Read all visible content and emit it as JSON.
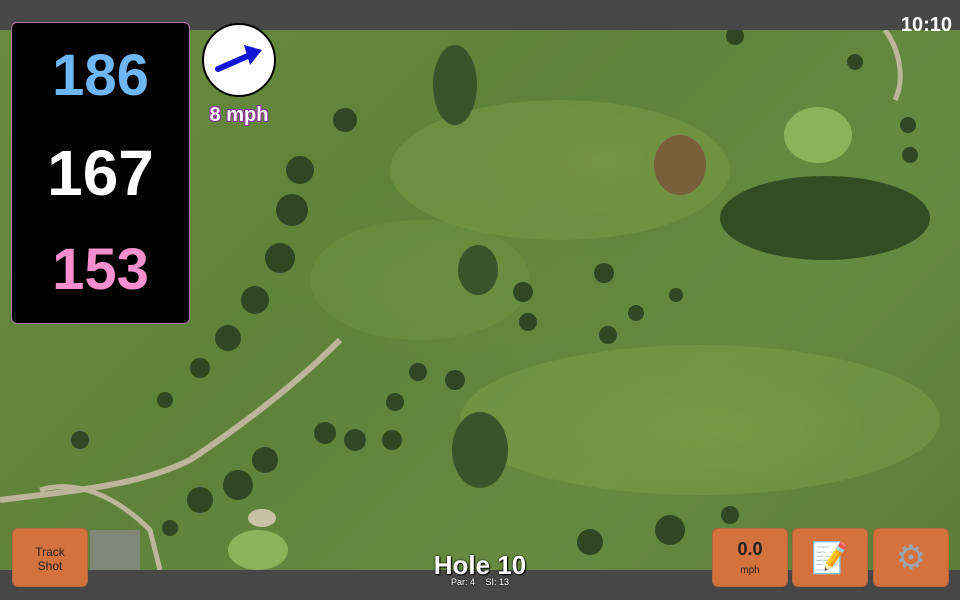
{
  "clock": "10:10",
  "yardages": {
    "back": "186",
    "middle": "167",
    "front": "153"
  },
  "wind": {
    "speed_label": "8 mph",
    "direction_icon": "arrow-icon"
  },
  "hole": {
    "title": "Hole 10",
    "par": "Par: 4",
    "si": "SI: 13"
  },
  "buttons": {
    "track_line1": "Track",
    "track_line2": "Shot",
    "speed_value": "0.0",
    "speed_unit": "mph",
    "notes_icon": "notepad-icon",
    "settings_icon": "gear-icon"
  },
  "colors": {
    "back_yardage": "#6fb6f5",
    "middle_yardage": "#ffffff",
    "front_yardage": "#f58fce",
    "button_bg": "#d4723e",
    "wind_arrow": "#1016d6"
  }
}
